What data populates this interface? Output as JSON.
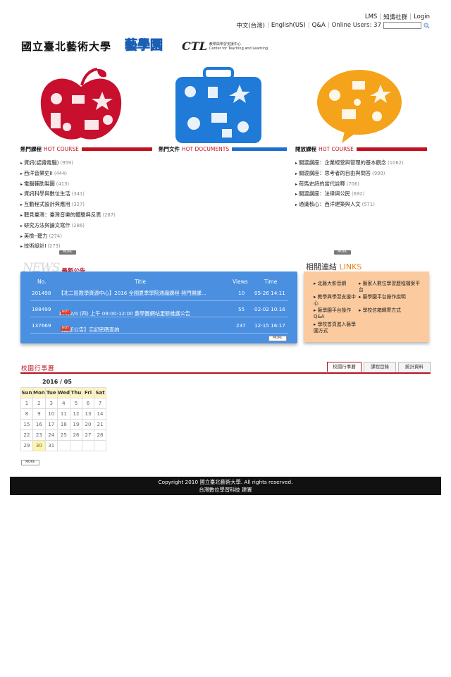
{
  "top_links": {
    "row1": [
      "LMS",
      "知識社群",
      "Login"
    ],
    "row2": [
      "中文(台灣)",
      "English(US)",
      "Q&A"
    ],
    "online_users_label": "Online Users: 37",
    "search_placeholder": ""
  },
  "header": {
    "university_name": "國立臺北藝術大學",
    "site_logo_text": "藝學園",
    "ctl_mark": "CTL",
    "ctl_name_zh": "教學與學習支援中心",
    "ctl_name_en": "Center for Teaching and Learning"
  },
  "sections": {
    "hot_course": {
      "zh": "熱門課程",
      "en": "HOT COURSE"
    },
    "hot_documents": {
      "zh": "熱門文件",
      "en": "HOT DOCUMENTS"
    },
    "open_course": {
      "zh": "開放課程",
      "en": "HOT COURSE"
    }
  },
  "hot_courses": [
    {
      "name": "資訊(認識電腦)",
      "count": "(959)"
    },
    {
      "name": "西洋音樂史II",
      "count": "(444)"
    },
    {
      "name": "電腦輔助製圖",
      "count": "(413)"
    },
    {
      "name": "資訊科學與數位生活",
      "count": "(341)"
    },
    {
      "name": "互動程式設計與應用",
      "count": "(327)"
    },
    {
      "name": "聽見臺灣：臺灣音樂的體驗與反思",
      "count": "(287)"
    },
    {
      "name": "研究方法與論文寫作",
      "count": "(286)"
    },
    {
      "name": "英檢─聽力",
      "count": "(274)"
    },
    {
      "name": "技術設計I",
      "count": "(273)"
    }
  ],
  "open_courses": [
    {
      "name": "關渡講座：企業經營與管理的基本觀念",
      "count": "(1062)"
    },
    {
      "name": "關渡講座：思考者的自由與問答",
      "count": "(999)"
    },
    {
      "name": "荷馬史詩的當代詮釋",
      "count": "(706)"
    },
    {
      "name": "關渡講座：法律與公民",
      "count": "(692)"
    },
    {
      "name": "通識核心：西洋建築與人文",
      "count": "(571)"
    }
  ],
  "more_label": "MORE",
  "news": {
    "title_big": "NEWS",
    "title_zh": "最新公告",
    "columns": {
      "no": "No.",
      "title": "Title",
      "views": "Views",
      "time": "Time"
    },
    "rows": [
      {
        "no": "201498",
        "title": "【北二區教學資源中心】2016 全國夏季學院通識課程-熱門開課...",
        "hot": false,
        "views": "10",
        "time": "05-26 14:11"
      },
      {
        "no": "188499",
        "title": "105/2/4 (四) 上午 09:00-12:00 藝學園網站更新維護公告",
        "hot": true,
        "views": "55",
        "time": "02-02 10:16"
      },
      {
        "no": "137669",
        "title": "【最新公告】忘記密碼查詢",
        "hot": true,
        "views": "237",
        "time": "12-15 16:17"
      }
    ],
    "hot_label": "HOT"
  },
  "links": {
    "title_zh": "相關連結",
    "title_en": "LINKS",
    "col1": [
      "北藝大影音網",
      "教學與學習支援中心",
      "藝學園平台操作Q&A",
      "學校首頁進入藝學園方式"
    ],
    "col2": [
      "藝家人數位學習歷程檔案平台",
      "藝學園平台操作說明",
      "學校信箱轉寄方式"
    ]
  },
  "calendar": {
    "title": "校園行事曆",
    "tabs": [
      "校園行事曆",
      "課程目錄",
      "統計資料"
    ],
    "month": "2016 / 05",
    "weekdays": [
      "Sun",
      "Mon",
      "Tue",
      "Wed",
      "Thu",
      "Fri",
      "Sat"
    ],
    "weeks": [
      [
        "1",
        "2",
        "3",
        "4",
        "5",
        "6",
        "7"
      ],
      [
        "8",
        "9",
        "10",
        "11",
        "12",
        "13",
        "14"
      ],
      [
        "15",
        "16",
        "17",
        "18",
        "19",
        "20",
        "21"
      ],
      [
        "22",
        "23",
        "24",
        "25",
        "26",
        "27",
        "28"
      ],
      [
        "29",
        "30",
        "31",
        "",
        "",
        "",
        ""
      ]
    ],
    "today": "30"
  },
  "footer": {
    "line1": "Copyright 2010 國立臺北藝術大學. All rights reserved.",
    "line2": "台灣數位學習科技 建置"
  },
  "colors": {
    "accent_red": "#c0131f",
    "news_blue": "#4a8fe0",
    "links_orange": "#fbcb9f",
    "apple_red": "#c8102e",
    "suitcase_blue": "#1f7ad8",
    "bubble_orange": "#f5a31a"
  }
}
